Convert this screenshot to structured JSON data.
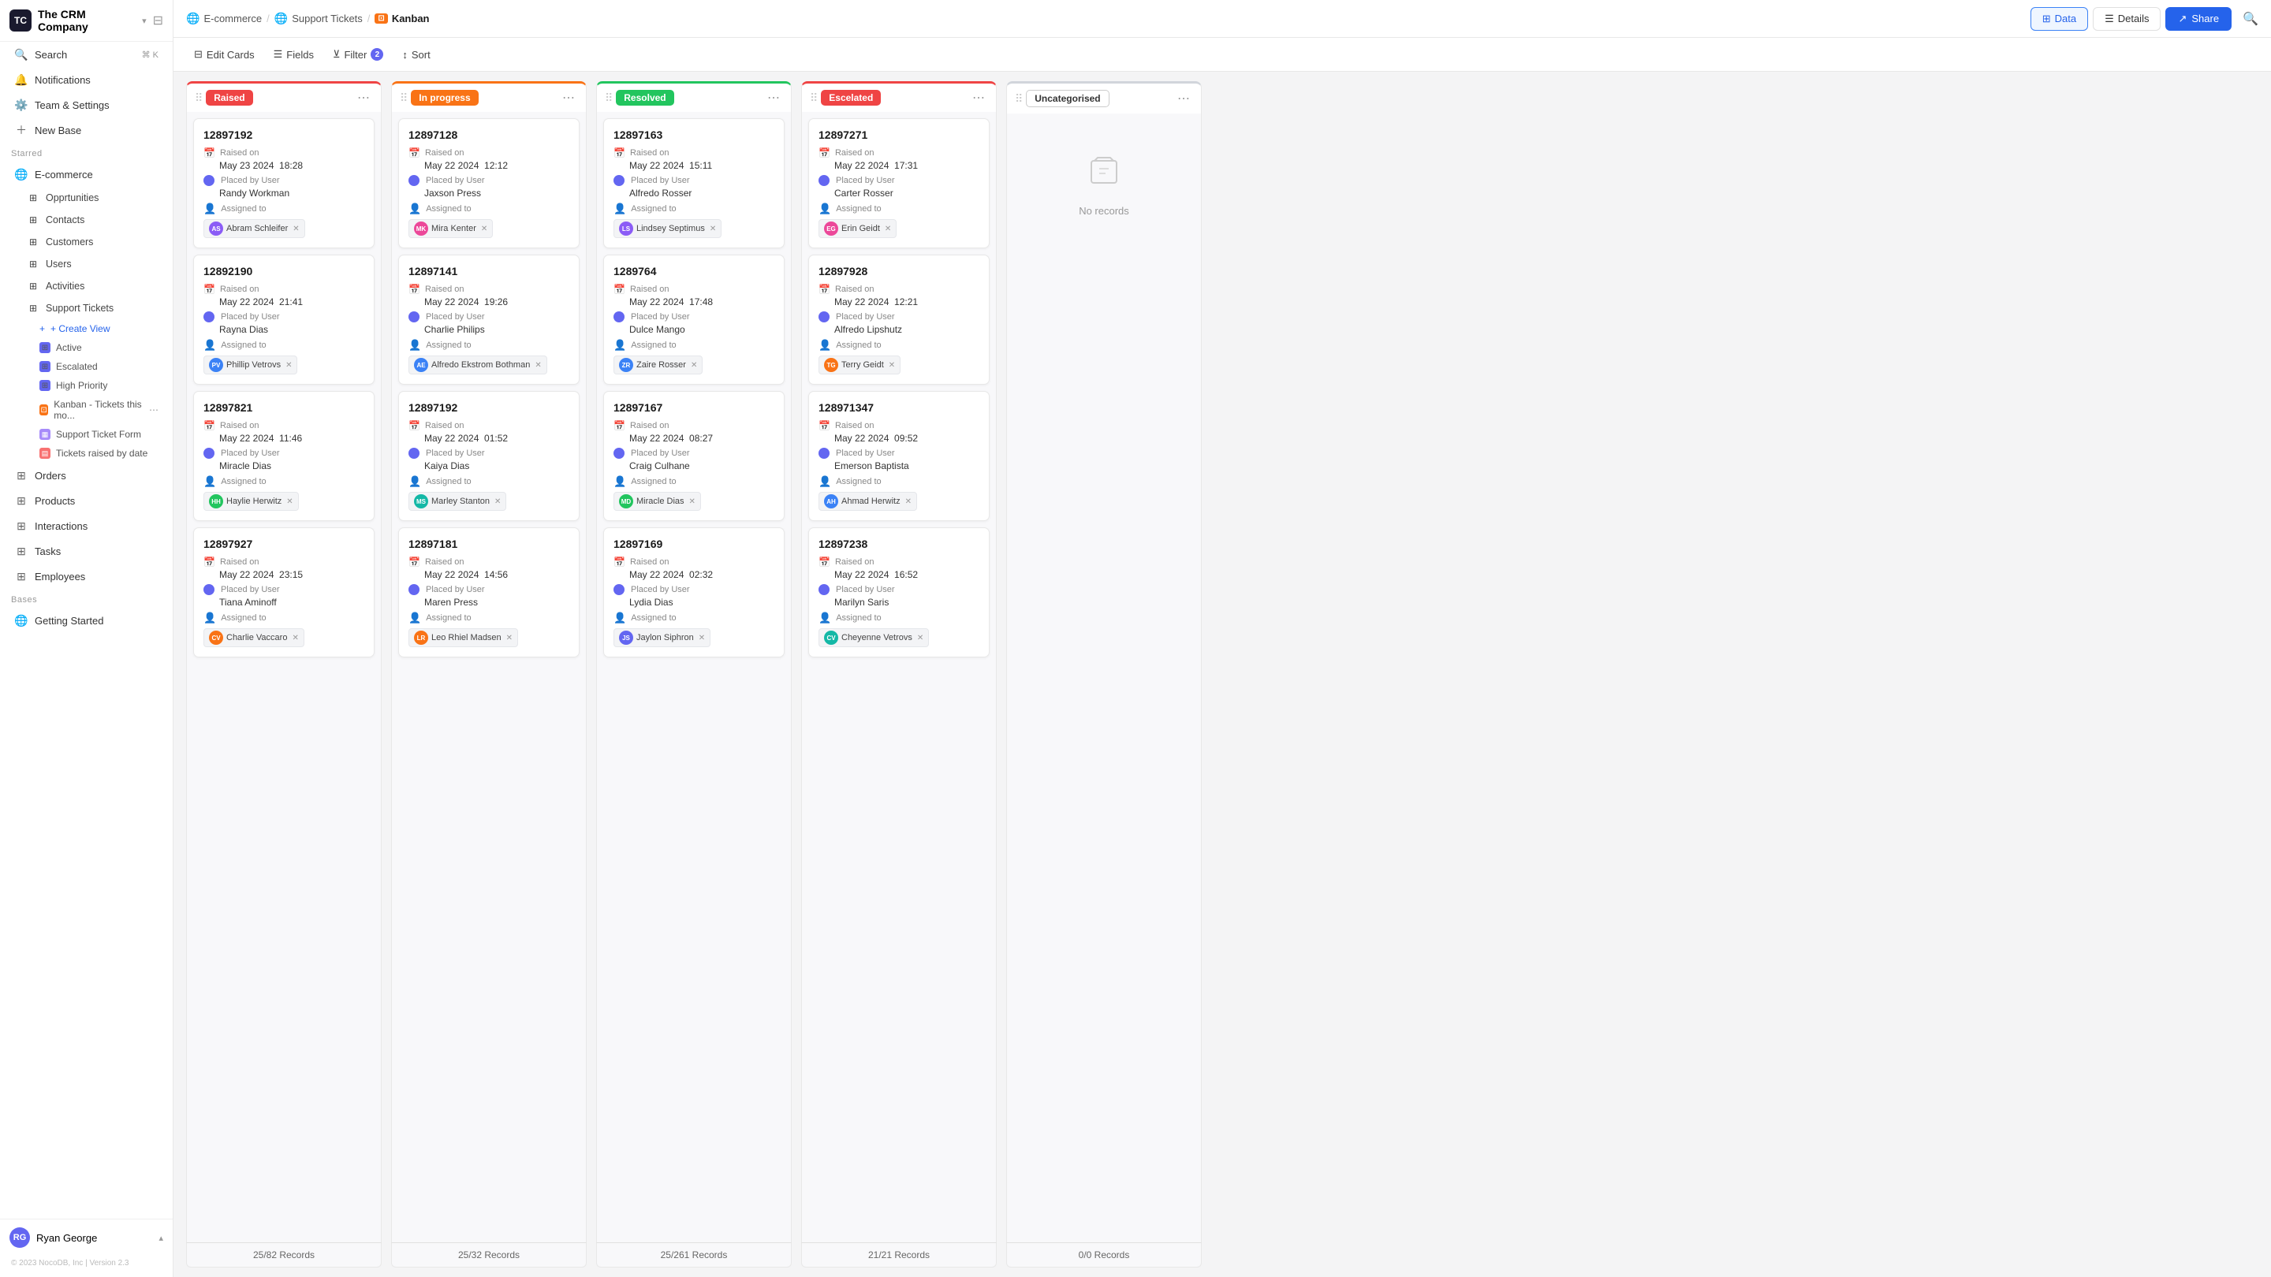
{
  "company": {
    "name": "The CRM Company",
    "logo": "TC"
  },
  "sidebar": {
    "top_items": [
      {
        "id": "search",
        "label": "Search",
        "icon": "🔍",
        "shortcut": "⌘ K"
      },
      {
        "id": "notifications",
        "label": "Notifications",
        "icon": "🔔"
      },
      {
        "id": "team",
        "label": "Team & Settings",
        "icon": "⚙️"
      },
      {
        "id": "newbase",
        "label": "New Base",
        "icon": "➕"
      }
    ],
    "starred_label": "Starred",
    "ecommerce": {
      "label": "E-commerce",
      "icon": "🌐",
      "children": [
        {
          "id": "opportunities",
          "label": "Opprtunities"
        },
        {
          "id": "contacts",
          "label": "Contacts"
        },
        {
          "id": "customers",
          "label": "Customers"
        },
        {
          "id": "users",
          "label": "Users"
        },
        {
          "id": "activities",
          "label": "Activities"
        },
        {
          "id": "supporttickets",
          "label": "Support Tickets"
        }
      ]
    },
    "support_ticket_views": {
      "create_view": "+ Create View",
      "views": [
        {
          "id": "active",
          "label": "Active",
          "color": "#6366f1"
        },
        {
          "id": "escalated",
          "label": "Escalated",
          "color": "#6366f1"
        },
        {
          "id": "highpriority",
          "label": "High Priority",
          "color": "#6366f1"
        },
        {
          "id": "kanban",
          "label": "Kanban - Tickets this mo...",
          "color": "#f97316",
          "active": true
        },
        {
          "id": "form",
          "label": "Support Ticket Form",
          "color": "#a78bfa"
        },
        {
          "id": "raised",
          "label": "Tickets raised by date",
          "color": "#f87171"
        }
      ]
    },
    "other_items": [
      {
        "id": "orders",
        "label": "Orders"
      },
      {
        "id": "products",
        "label": "Products"
      },
      {
        "id": "interactions",
        "label": "Interactions"
      },
      {
        "id": "tasks",
        "label": "Tasks"
      },
      {
        "id": "employees",
        "label": "Employees"
      }
    ],
    "bases_label": "Bases",
    "getting_started": "Getting Started",
    "user": {
      "name": "Ryan George",
      "initials": "RG"
    },
    "copyright": "© 2023 NocoDB, Inc | Version 2.3"
  },
  "topbar": {
    "breadcrumbs": [
      {
        "id": "ecommerce",
        "label": "E-commerce",
        "icon": "🌐"
      },
      {
        "id": "supporttickets",
        "label": "Support Tickets",
        "icon": "🌐"
      },
      {
        "id": "kanban",
        "label": "Kanban",
        "type": "current"
      }
    ],
    "data_btn": "Data",
    "details_btn": "Details",
    "share_btn": "Share"
  },
  "toolbar": {
    "edit_cards": "Edit Cards",
    "fields": "Fields",
    "filter": "Filter",
    "filter_count": "2",
    "sort": "Sort"
  },
  "columns": [
    {
      "id": "raised",
      "title": "Raised",
      "badge_class": "badge-raised",
      "color_class": "col-raised",
      "records_label": "25/82 Records",
      "cards": [
        {
          "id": "12897192",
          "raised_on": "May 23 2024",
          "raised_time": "18:28",
          "placed_by": "Randy Workman",
          "assigned_to": [
            {
              "name": "Abram Schleifer",
              "initials": "AS",
              "color": "av-purple"
            }
          ]
        },
        {
          "id": "12892190",
          "raised_on": "May 22 2024",
          "raised_time": "21:41",
          "placed_by": "Rayna Dias",
          "assigned_to": [
            {
              "name": "Phillip Vetrovs",
              "initials": "PV",
              "color": "av-blue"
            }
          ]
        },
        {
          "id": "12897821",
          "raised_on": "May 22 2024",
          "raised_time": "11:46",
          "placed_by": "Miracle Dias",
          "assigned_to": [
            {
              "name": "Haylie Herwitz",
              "initials": "HH",
              "color": "av-green"
            }
          ]
        },
        {
          "id": "12897927",
          "raised_on": "May 22 2024",
          "raised_time": "23:15",
          "placed_by": "Tiana Aminoff",
          "assigned_to": [
            {
              "name": "Charlie Vaccaro",
              "initials": "CV",
              "color": "av-orange"
            }
          ]
        }
      ]
    },
    {
      "id": "inprogress",
      "title": "In progress",
      "badge_class": "badge-inprogress",
      "color_class": "col-inprogress",
      "records_label": "25/32 Records",
      "cards": [
        {
          "id": "12897128",
          "raised_on": "May 22 2024",
          "raised_time": "12:12",
          "placed_by": "Jaxson Press",
          "assigned_to": [
            {
              "name": "Mira Kenter",
              "initials": "MK",
              "color": "av-pink"
            }
          ]
        },
        {
          "id": "12897141",
          "raised_on": "May 22 2024",
          "raised_time": "19:26",
          "placed_by": "Charlie Philips",
          "assigned_to": [
            {
              "name": "Alfredo Ekstrom Bothman",
              "initials": "AE",
              "color": "av-blue"
            }
          ]
        },
        {
          "id": "12897192",
          "raised_on": "May 22 2024",
          "raised_time": "01:52",
          "placed_by": "Kaiya Dias",
          "assigned_to": [
            {
              "name": "Marley Stanton",
              "initials": "MS",
              "color": "av-teal"
            }
          ]
        },
        {
          "id": "12897181",
          "raised_on": "May 22 2024",
          "raised_time": "14:56",
          "placed_by": "Maren Press",
          "assigned_to": [
            {
              "name": "Leo Rhiel Madsen",
              "initials": "LR",
              "color": "av-orange"
            }
          ]
        }
      ]
    },
    {
      "id": "resolved",
      "title": "Resolved",
      "badge_class": "badge-resolved",
      "color_class": "col-resolved",
      "records_label": "25/261 Records",
      "cards": [
        {
          "id": "12897163",
          "raised_on": "May 22 2024",
          "raised_time": "15:11",
          "placed_by": "Alfredo Rosser",
          "assigned_to": [
            {
              "name": "Lindsey Septimus",
              "initials": "LS",
              "color": "av-purple"
            }
          ]
        },
        {
          "id": "1289764",
          "raised_on": "May 22 2024",
          "raised_time": "17:48",
          "placed_by": "Dulce Mango",
          "assigned_to": [
            {
              "name": "Zaire Rosser",
              "initials": "ZR",
              "color": "av-blue"
            }
          ]
        },
        {
          "id": "12897167",
          "raised_on": "May 22 2024",
          "raised_time": "08:27",
          "placed_by": "Craig Culhane",
          "assigned_to": [
            {
              "name": "Miracle Dias",
              "initials": "MD",
              "color": "av-green"
            }
          ]
        },
        {
          "id": "12897169",
          "raised_on": "May 22 2024",
          "raised_time": "02:32",
          "placed_by": "Lydia Dias",
          "assigned_to": [
            {
              "name": "Jaylon Siphron",
              "initials": "JS",
              "color": "av-indigo"
            }
          ]
        }
      ]
    },
    {
      "id": "escalated",
      "title": "Escelated",
      "badge_class": "badge-escalated",
      "color_class": "col-escalated",
      "records_label": "21/21 Records",
      "cards": [
        {
          "id": "12897271",
          "raised_on": "May 22 2024",
          "raised_time": "17:31",
          "placed_by": "Carter Rosser",
          "assigned_to": [
            {
              "name": "Erin Geidt",
              "initials": "EG",
              "color": "av-pink"
            }
          ]
        },
        {
          "id": "12897928",
          "raised_on": "May 22 2024",
          "raised_time": "12:21",
          "placed_by": "Alfredo Lipshutz",
          "assigned_to": [
            {
              "name": "Terry Geidt",
              "initials": "TG",
              "color": "av-orange"
            }
          ]
        },
        {
          "id": "128971347",
          "raised_on": "May 22 2024",
          "raised_time": "09:52",
          "placed_by": "Emerson Baptista",
          "assigned_to": [
            {
              "name": "Ahmad Herwitz",
              "initials": "AH",
              "color": "av-blue"
            }
          ]
        },
        {
          "id": "12897238",
          "raised_on": "May 22 2024",
          "raised_time": "16:52",
          "placed_by": "Marilyn Saris",
          "assigned_to": [
            {
              "name": "Cheyenne Vetrovs",
              "initials": "CV",
              "color": "av-teal"
            }
          ]
        }
      ]
    },
    {
      "id": "uncategorised",
      "title": "Uncategorised",
      "badge_class": "badge-uncategorised",
      "color_class": "col-uncategorised",
      "records_label": "0/0 Records",
      "cards": []
    }
  ],
  "labels": {
    "raised_on": "Raised on",
    "placed_by_user": "Placed by User",
    "assigned_to": "Assigned to",
    "no_records": "No records"
  }
}
